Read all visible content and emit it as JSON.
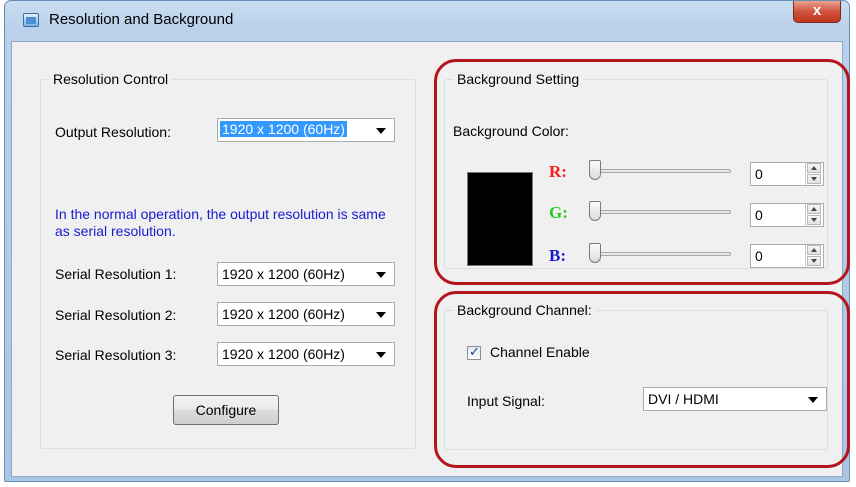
{
  "window": {
    "title": "Resolution and Background",
    "close_label": "x"
  },
  "resolution_control": {
    "legend": "Resolution Control",
    "output_label": "Output Resolution:",
    "output_value": "1920 x 1200 (60Hz)",
    "note": "In the normal operation, the output resolution is same as serial resolution.",
    "serial_rows": [
      {
        "label": "Serial Resolution 1:",
        "value": "1920 x 1200 (60Hz)"
      },
      {
        "label": "Serial Resolution 2:",
        "value": "1920 x 1200 (60Hz)"
      },
      {
        "label": "Serial Resolution 3:",
        "value": "1920 x 1200 (60Hz)"
      }
    ],
    "configure_label": "Configure"
  },
  "background_setting": {
    "legend": "Background Setting",
    "color_label": "Background Color:",
    "swatch_color": "#000000",
    "channels": [
      {
        "label": "R:",
        "color": "#ff1a1a",
        "value": "0"
      },
      {
        "label": "G:",
        "color": "#22cc22",
        "value": "0"
      },
      {
        "label": "B:",
        "color": "#1a1acc",
        "value": "0"
      }
    ]
  },
  "background_channel": {
    "legend": "Background Channel:",
    "enable_label": "Channel Enable",
    "enable_checked": true,
    "input_label": "Input Signal:",
    "input_value": "DVI / HDMI"
  },
  "colors": {
    "highlight": "#b3151b",
    "note_text": "#1a1ad0"
  }
}
